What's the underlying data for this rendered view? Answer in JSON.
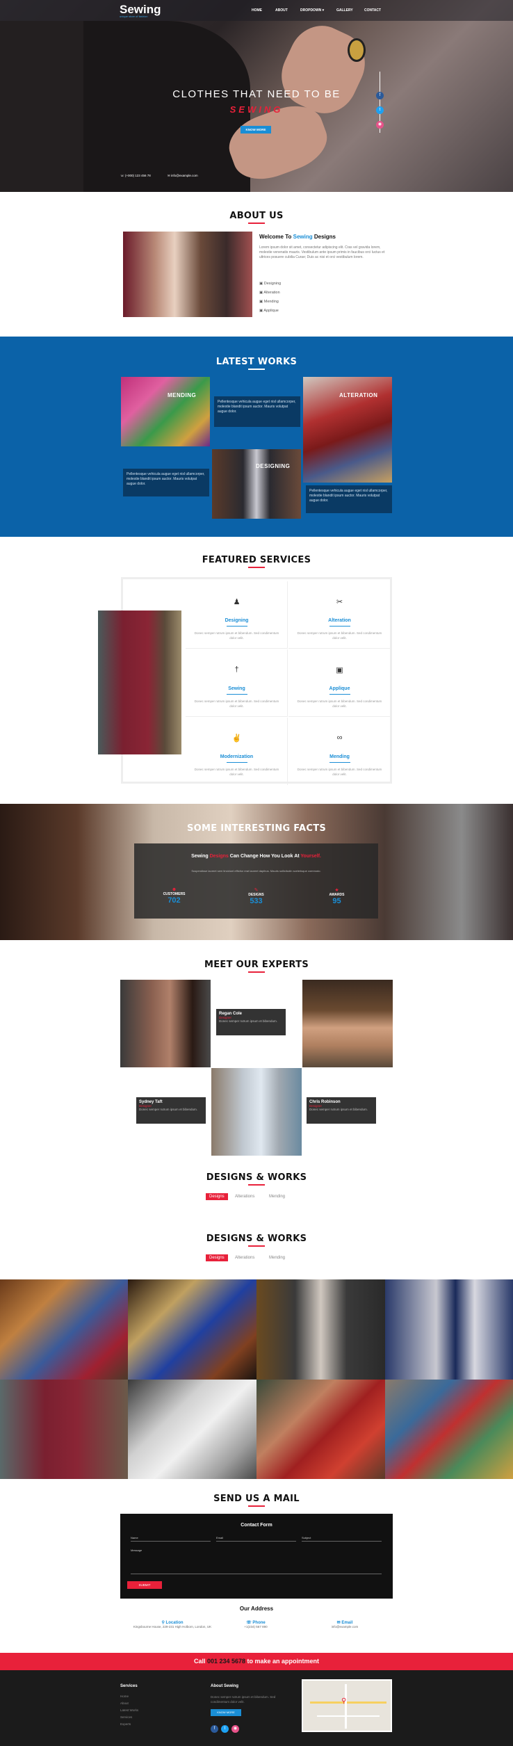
{
  "header": {
    "logo": "Sewing",
    "tagline": "unique store of fashion",
    "nav": [
      "HOME",
      "ABOUT",
      "DROPDOWN ▾",
      "GALLERY",
      "CONTACT"
    ]
  },
  "hero": {
    "line1": "CLOTHES THAT NEED TO BE",
    "line2": "SEWING",
    "button": "KNOW MORE",
    "phone": "(+000) 123 456 78",
    "email": "info@example.com"
  },
  "about": {
    "title": "ABOUT US",
    "welcome_prefix": "Welcome To ",
    "welcome_brand": "Sewing",
    "welcome_suffix": " Designs",
    "para": "Lorem ipsum dolor sit amet, consectetur adipiscing elit. Cras vel gravida lorem, molestie venenatis mauris. Vestibulum ante ipsum primis in faucibus orci luctus et ultrices posuere cubilia Curae; Duis ac nisi et orci vestibulum lorem.",
    "list": [
      "Designing",
      "Alteration",
      "Mending",
      "Applique"
    ]
  },
  "works": {
    "title": "LATEST WORKS",
    "labels": [
      "MENDING",
      "ALTERATION",
      "DESIGNING"
    ],
    "desc": "Pellentesque vehicula augue eget nisl ullamcorper, molestie blandit ipsum auctor. Mauris volutpat augue dolor."
  },
  "services": {
    "title": "FEATURED SERVICES",
    "items": [
      {
        "name": "Designing",
        "icon": "♟"
      },
      {
        "name": "Alteration",
        "icon": "✂"
      },
      {
        "name": "Sewing",
        "icon": "†"
      },
      {
        "name": "Applique",
        "icon": "▣"
      },
      {
        "name": "Modernization",
        "icon": "✌"
      },
      {
        "name": "Mending",
        "icon": "∞"
      }
    ],
    "desc": "Donec semper rutrum ipsum et bibendum. Sed condimentum dolor velit."
  },
  "facts": {
    "title": "SOME INTERESTING FACTS",
    "head_prefix": "Sewing ",
    "head_brand": "Designs",
    "head_mid": " Can Change How You Look At ",
    "head_end": "Yourself.",
    "sub": "Suspendisse laoreet sem tincidunt efficitur erat laoreet dapibus. Mauris sollicitudin scelerisque commodo.",
    "stats": [
      {
        "label": "CUSTOMERS",
        "value": "702"
      },
      {
        "label": "DESIGNS",
        "value": "533"
      },
      {
        "label": "AWARDS",
        "value": "95"
      }
    ]
  },
  "experts": {
    "title": "MEET OUR EXPERTS",
    "people": [
      {
        "name": "Regan Cole",
        "role": "Designer",
        "desc": "Donec semper rutrum ipsum et bibendum."
      },
      {
        "name": "Sydney Taft",
        "role": "Designer",
        "desc": "Donec semper rutrum ipsum et bibendum."
      },
      {
        "name": "Chris Robinson",
        "role": "Designer",
        "desc": "Donec semper rutrum ipsum et bibendum."
      }
    ]
  },
  "designs": {
    "title": "DESIGNS & WORKS",
    "tabs": [
      "Designs",
      "Alterations",
      "Mending"
    ]
  },
  "mail": {
    "title": "SEND US A MAIL",
    "form_title": "Contact Form",
    "name": "Name",
    "email": "Email",
    "subject": "Subject",
    "message": "Message",
    "submit": "SUBMIT"
  },
  "address": {
    "title": "Our Address",
    "location_label": "Location",
    "location": "Kingsbourne House, 229-231 High Holborn, London, UK",
    "phone_label": "Phone",
    "phone": "+1(234) 567 890",
    "email_label": "Email",
    "email": "info@example.com"
  },
  "appointment": {
    "prefix": "Call ",
    "number": "001 234 5678",
    "suffix": " to make an appointment"
  },
  "footer": {
    "services_title": "Services",
    "services": [
      "Home",
      "About",
      "Latest Works",
      "Services",
      "Experts"
    ],
    "about_title": "About Sewing",
    "about_text": "Donec semper rutrum ipsum et bibendum. Sed condimentum dolor velit.",
    "about_button": "KNOW MORE"
  },
  "colors": {
    "accent": "#e8213a",
    "blue": "#1a8ed6",
    "works_bg": "#0b62a8"
  }
}
